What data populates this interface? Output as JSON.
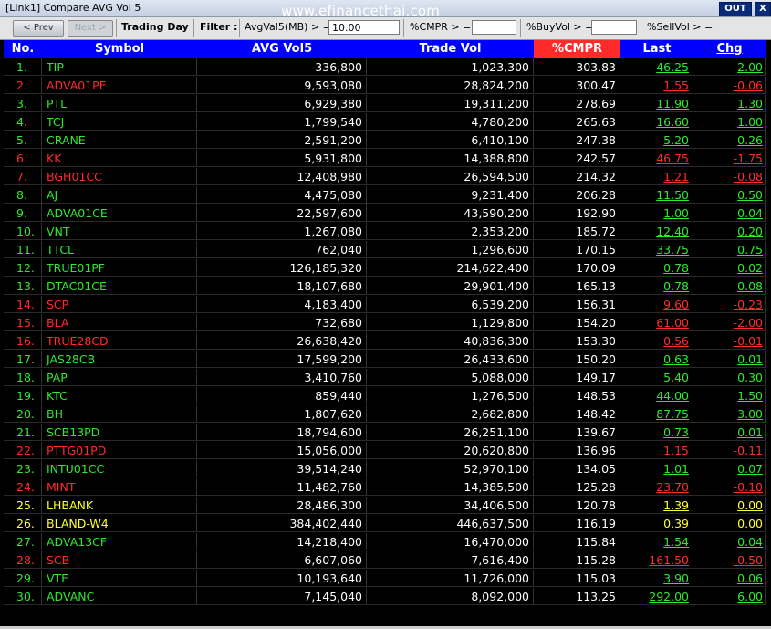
{
  "window": {
    "title": "[Link1] Compare AVG Vol 5",
    "out_label": "OUT",
    "close_label": "X",
    "watermark": "www.efinancethai.com"
  },
  "toolbar": {
    "prev_label": "< Prev",
    "next_label": "Next >",
    "trading_day": "Trading Day",
    "filter_label": "Filter :",
    "avgvol_label": "AvgVal5(MB) > =",
    "avgvol_value": "10.00",
    "cmpr_label": "%CMPR > =",
    "cmpr_value": "",
    "buyvol_label": "%BuyVol > =",
    "buyvol_value": "",
    "sellvol_label": "%SellVol > ="
  },
  "table": {
    "headers": [
      "No.",
      "Symbol",
      "AVG Vol5",
      "Trade Vol",
      "%CMPR",
      "Last",
      "Chg"
    ],
    "rows": [
      {
        "no": "1.",
        "symbol": "TIP",
        "avg": "336,800",
        "tv": "1,023,300",
        "cmpr": "303.83",
        "last": "46.25",
        "chg": "2.00",
        "trend": "up"
      },
      {
        "no": "2.",
        "symbol": "ADVA01PE",
        "avg": "9,593,080",
        "tv": "28,824,200",
        "cmpr": "300.47",
        "last": "1.55",
        "chg": "-0.06",
        "trend": "down"
      },
      {
        "no": "3.",
        "symbol": "PTL",
        "avg": "6,929,380",
        "tv": "19,311,200",
        "cmpr": "278.69",
        "last": "11.90",
        "chg": "1.30",
        "trend": "up"
      },
      {
        "no": "4.",
        "symbol": "TCJ",
        "avg": "1,799,540",
        "tv": "4,780,200",
        "cmpr": "265.63",
        "last": "16.60",
        "chg": "1.00",
        "trend": "up"
      },
      {
        "no": "5.",
        "symbol": "CRANE",
        "avg": "2,591,200",
        "tv": "6,410,100",
        "cmpr": "247.38",
        "last": "5.20",
        "chg": "0.26",
        "trend": "up"
      },
      {
        "no": "6.",
        "symbol": "KK",
        "avg": "5,931,800",
        "tv": "14,388,800",
        "cmpr": "242.57",
        "last": "46.75",
        "chg": "-1.75",
        "trend": "down"
      },
      {
        "no": "7.",
        "symbol": "BGH01CC",
        "avg": "12,408,980",
        "tv": "26,594,500",
        "cmpr": "214.32",
        "last": "1.21",
        "chg": "-0.08",
        "trend": "down"
      },
      {
        "no": "8.",
        "symbol": "AJ",
        "avg": "4,475,080",
        "tv": "9,231,400",
        "cmpr": "206.28",
        "last": "11.50",
        "chg": "0.50",
        "trend": "up"
      },
      {
        "no": "9.",
        "symbol": "ADVA01CE",
        "avg": "22,597,600",
        "tv": "43,590,200",
        "cmpr": "192.90",
        "last": "1.00",
        "chg": "0.04",
        "trend": "up"
      },
      {
        "no": "10.",
        "symbol": "VNT",
        "avg": "1,267,080",
        "tv": "2,353,200",
        "cmpr": "185.72",
        "last": "12.40",
        "chg": "0.20",
        "trend": "up"
      },
      {
        "no": "11.",
        "symbol": "TTCL",
        "avg": "762,040",
        "tv": "1,296,600",
        "cmpr": "170.15",
        "last": "33.75",
        "chg": "0.75",
        "trend": "up"
      },
      {
        "no": "12.",
        "symbol": "TRUE01PF",
        "avg": "126,185,320",
        "tv": "214,622,400",
        "cmpr": "170.09",
        "last": "0.78",
        "chg": "0.02",
        "trend": "up"
      },
      {
        "no": "13.",
        "symbol": "DTAC01CE",
        "avg": "18,107,680",
        "tv": "29,901,400",
        "cmpr": "165.13",
        "last": "0.78",
        "chg": "0.08",
        "trend": "up"
      },
      {
        "no": "14.",
        "symbol": "SCP",
        "avg": "4,183,400",
        "tv": "6,539,200",
        "cmpr": "156.31",
        "last": "9.60",
        "chg": "-0.23",
        "trend": "down"
      },
      {
        "no": "15.",
        "symbol": "BLA",
        "avg": "732,680",
        "tv": "1,129,800",
        "cmpr": "154.20",
        "last": "61.00",
        "chg": "-2.00",
        "trend": "down"
      },
      {
        "no": "16.",
        "symbol": "TRUE28CD",
        "avg": "26,638,420",
        "tv": "40,836,300",
        "cmpr": "153.30",
        "last": "0.56",
        "chg": "-0.01",
        "trend": "down"
      },
      {
        "no": "17.",
        "symbol": "JAS28CB",
        "avg": "17,599,200",
        "tv": "26,433,600",
        "cmpr": "150.20",
        "last": "0.63",
        "chg": "0.01",
        "trend": "up"
      },
      {
        "no": "18.",
        "symbol": "PAP",
        "avg": "3,410,760",
        "tv": "5,088,000",
        "cmpr": "149.17",
        "last": "5.40",
        "chg": "0.30",
        "trend": "up"
      },
      {
        "no": "19.",
        "symbol": "KTC",
        "avg": "859,440",
        "tv": "1,276,500",
        "cmpr": "148.53",
        "last": "44.00",
        "chg": "1.50",
        "trend": "up"
      },
      {
        "no": "20.",
        "symbol": "BH",
        "avg": "1,807,620",
        "tv": "2,682,800",
        "cmpr": "148.42",
        "last": "87.75",
        "chg": "3.00",
        "trend": "up"
      },
      {
        "no": "21.",
        "symbol": "SCB13PD",
        "avg": "18,794,600",
        "tv": "26,251,100",
        "cmpr": "139.67",
        "last": "0.73",
        "chg": "0.01",
        "trend": "up"
      },
      {
        "no": "22.",
        "symbol": "PTTG01PD",
        "avg": "15,056,000",
        "tv": "20,620,800",
        "cmpr": "136.96",
        "last": "1.15",
        "chg": "-0.11",
        "trend": "down"
      },
      {
        "no": "23.",
        "symbol": "INTU01CC",
        "avg": "39,514,240",
        "tv": "52,970,100",
        "cmpr": "134.05",
        "last": "1.01",
        "chg": "0.07",
        "trend": "up"
      },
      {
        "no": "24.",
        "symbol": "MINT",
        "avg": "11,482,760",
        "tv": "14,385,500",
        "cmpr": "125.28",
        "last": "23.70",
        "chg": "-0.10",
        "trend": "down"
      },
      {
        "no": "25.",
        "symbol": "LHBANK",
        "avg": "28,486,300",
        "tv": "34,406,500",
        "cmpr": "120.78",
        "last": "1.39",
        "chg": "0.00",
        "trend": "flat"
      },
      {
        "no": "26.",
        "symbol": "BLAND-W4",
        "avg": "384,402,440",
        "tv": "446,637,500",
        "cmpr": "116.19",
        "last": "0.39",
        "chg": "0.00",
        "trend": "flat"
      },
      {
        "no": "27.",
        "symbol": "ADVA13CF",
        "avg": "14,218,400",
        "tv": "16,470,000",
        "cmpr": "115.84",
        "last": "1.54",
        "chg": "0.04",
        "trend": "up"
      },
      {
        "no": "28.",
        "symbol": "SCB",
        "avg": "6,607,060",
        "tv": "7,616,400",
        "cmpr": "115.28",
        "last": "161.50",
        "chg": "-0.50",
        "trend": "down"
      },
      {
        "no": "29.",
        "symbol": "VTE",
        "avg": "10,193,640",
        "tv": "11,726,000",
        "cmpr": "115.03",
        "last": "3.90",
        "chg": "0.06",
        "trend": "up"
      },
      {
        "no": "30.",
        "symbol": "ADVANC",
        "avg": "7,145,040",
        "tv": "8,092,000",
        "cmpr": "113.25",
        "last": "292.00",
        "chg": "6.00",
        "trend": "up"
      }
    ]
  },
  "colors": {
    "header_bg": "#0000ff",
    "cmpr_header_bg": "#ff2b2b",
    "up": "#2ee82e",
    "down": "#ff2b2b",
    "flat": "#ffff33"
  }
}
